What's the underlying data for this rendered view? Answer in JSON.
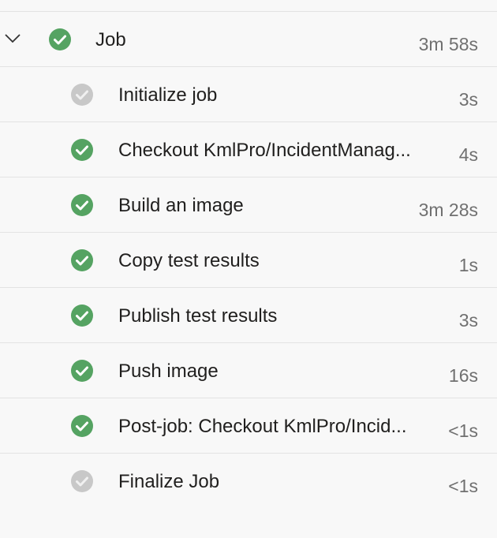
{
  "colors": {
    "success": "#55a362",
    "skipped": "#c8c8c8",
    "background": "#f8f8f8"
  },
  "job": {
    "label": "Job",
    "duration": "3m 58s",
    "status": "success",
    "expanded": true
  },
  "steps": [
    {
      "label": "Initialize job",
      "duration": "3s",
      "status": "skipped"
    },
    {
      "label": "Checkout KmlPro/IncidentManag...",
      "duration": "4s",
      "status": "success"
    },
    {
      "label": "Build an image",
      "duration": "3m 28s",
      "status": "success"
    },
    {
      "label": "Copy test results",
      "duration": "1s",
      "status": "success"
    },
    {
      "label": "Publish test results",
      "duration": "3s",
      "status": "success"
    },
    {
      "label": "Push image",
      "duration": "16s",
      "status": "success"
    },
    {
      "label": "Post-job: Checkout KmlPro/Incid...",
      "duration": "<1s",
      "status": "success"
    },
    {
      "label": "Finalize Job",
      "duration": "<1s",
      "status": "skipped"
    }
  ]
}
